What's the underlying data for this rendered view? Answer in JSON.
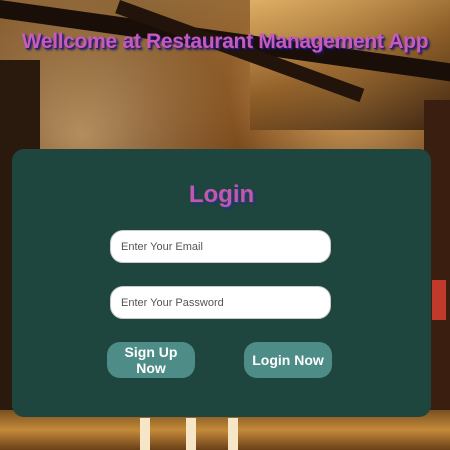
{
  "app": {
    "title": "Wellcome at Restaurant Management App"
  },
  "login_card": {
    "title": "Login",
    "email_placeholder": "Enter Your Email",
    "password_placeholder": "Enter Your Password",
    "signup_label": "Sign Up Now",
    "login_label": "Login Now"
  },
  "colors": {
    "card_background": "#1f463e",
    "button_background": "#4e8d87",
    "title_color": "#c85ab8"
  }
}
